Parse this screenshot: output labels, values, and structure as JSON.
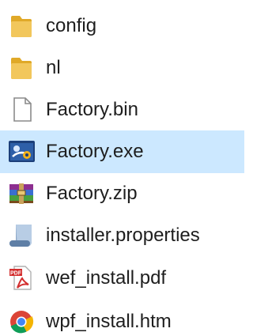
{
  "explorer": {
    "files": [
      {
        "name": "config",
        "icon": "folder-icon",
        "selected": false
      },
      {
        "name": "nl",
        "icon": "folder-icon",
        "selected": false
      },
      {
        "name": "Factory.bin",
        "icon": "blank-file-icon",
        "selected": false
      },
      {
        "name": "Factory.exe",
        "icon": "application-icon",
        "selected": true
      },
      {
        "name": "Factory.zip",
        "icon": "archive-icon",
        "selected": false
      },
      {
        "name": "installer.properties",
        "icon": "properties-file-icon",
        "selected": false
      },
      {
        "name": "wef_install.pdf",
        "icon": "pdf-icon",
        "selected": false
      },
      {
        "name": "wpf_install.htm",
        "icon": "chrome-html-icon",
        "selected": false
      }
    ],
    "colors": {
      "selection": "#cce8ff",
      "folder": "#f2c75c",
      "text": "#1e1e1e"
    }
  }
}
